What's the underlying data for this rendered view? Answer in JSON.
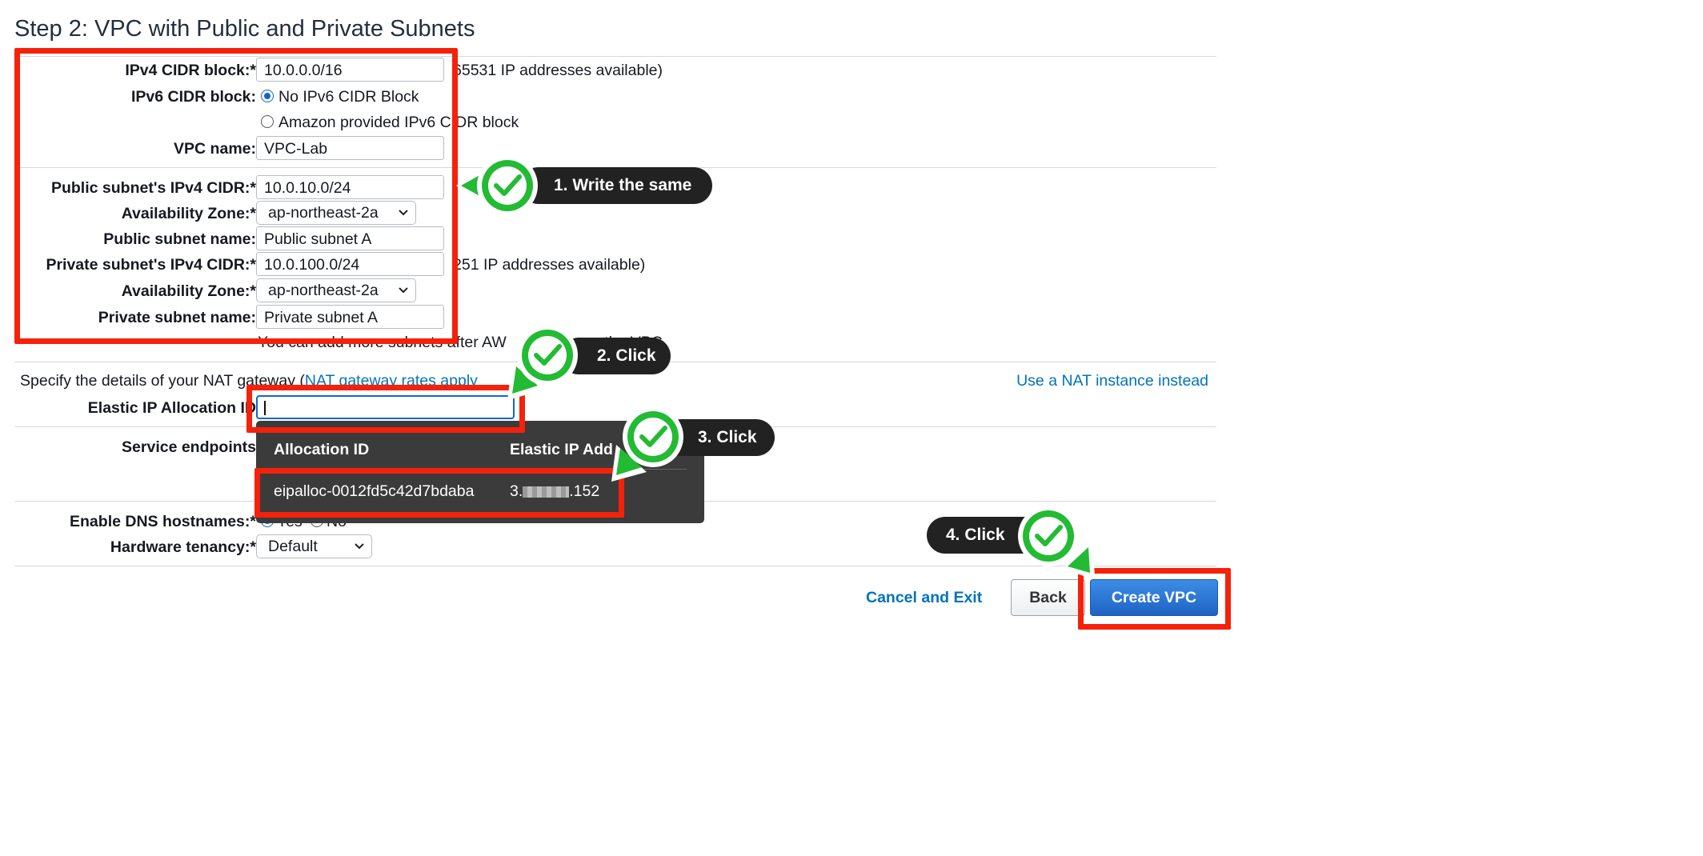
{
  "page": {
    "title": "Step 2: VPC with Public and Private Subnets"
  },
  "form": {
    "ipv4_label": "IPv4 CIDR block:*",
    "ipv4_value": "10.0.0.0/16",
    "ipv4_hint": "65531 IP addresses available)",
    "ipv6_label": "IPv6 CIDR block:",
    "ipv6_opt1": "No IPv6 CIDR Block",
    "ipv6_opt2": "Amazon provided IPv6 CIDR block",
    "vpc_name_label": "VPC name:",
    "vpc_name_value": "VPC-Lab",
    "public_cidr_label": "Public subnet's IPv4 CIDR:*",
    "public_cidr_value": "10.0.10.0/24",
    "public_cidr_hint": "es",
    "az_label_1": "Availability Zone:*",
    "az_value_1": "ap-northeast-2a",
    "public_name_label": "Public subnet name:",
    "public_name_value": "Public subnet A",
    "private_cidr_label": "Private subnet's IPv4 CIDR:*",
    "private_cidr_value": "10.0.100.0/24",
    "private_cidr_hint": "251 IP addresses available)",
    "az_label_2": "Availability Zone:*",
    "az_value_2": "ap-northeast-2a",
    "private_name_label": "Private subnet name:",
    "private_name_value": "Private subnet A",
    "subnet_note": "You can add more subnets after AW",
    "subnet_note_tail": "s the VPC.",
    "nat_text": "Specify the details of your NAT gateway (",
    "nat_link": "NAT gateway rates apply",
    "nat_instance_link": "Use a NAT instance instead",
    "eip_label": "Elastic IP Allocation ID",
    "eip_value": "",
    "endpoints_label": "Service endpoints",
    "dns_label": "Enable DNS hostnames:*",
    "dns_opt1": "Yes",
    "dns_opt2": "No",
    "tenancy_label": "Hardware tenancy:*",
    "tenancy_value": "Default"
  },
  "dropdown": {
    "col1": "Allocation ID",
    "col2": "Elastic IP Add",
    "row_id": "eipalloc-0012fd5c42d7bdaba",
    "row_ip_prefix": "3.",
    "row_ip_suffix": ".152"
  },
  "annotations": {
    "step1": "1. Write the same",
    "step2": "2. Click",
    "step3": "3. Click",
    "step4": "4. Click"
  },
  "buttons": {
    "cancel": "Cancel and Exit",
    "back": "Back",
    "create": "Create VPC"
  },
  "colors": {
    "annotation_red": "#f5210a",
    "check_green": "#22bb33",
    "link_blue": "#0073bb",
    "primary_button": "#1f6ed4"
  }
}
